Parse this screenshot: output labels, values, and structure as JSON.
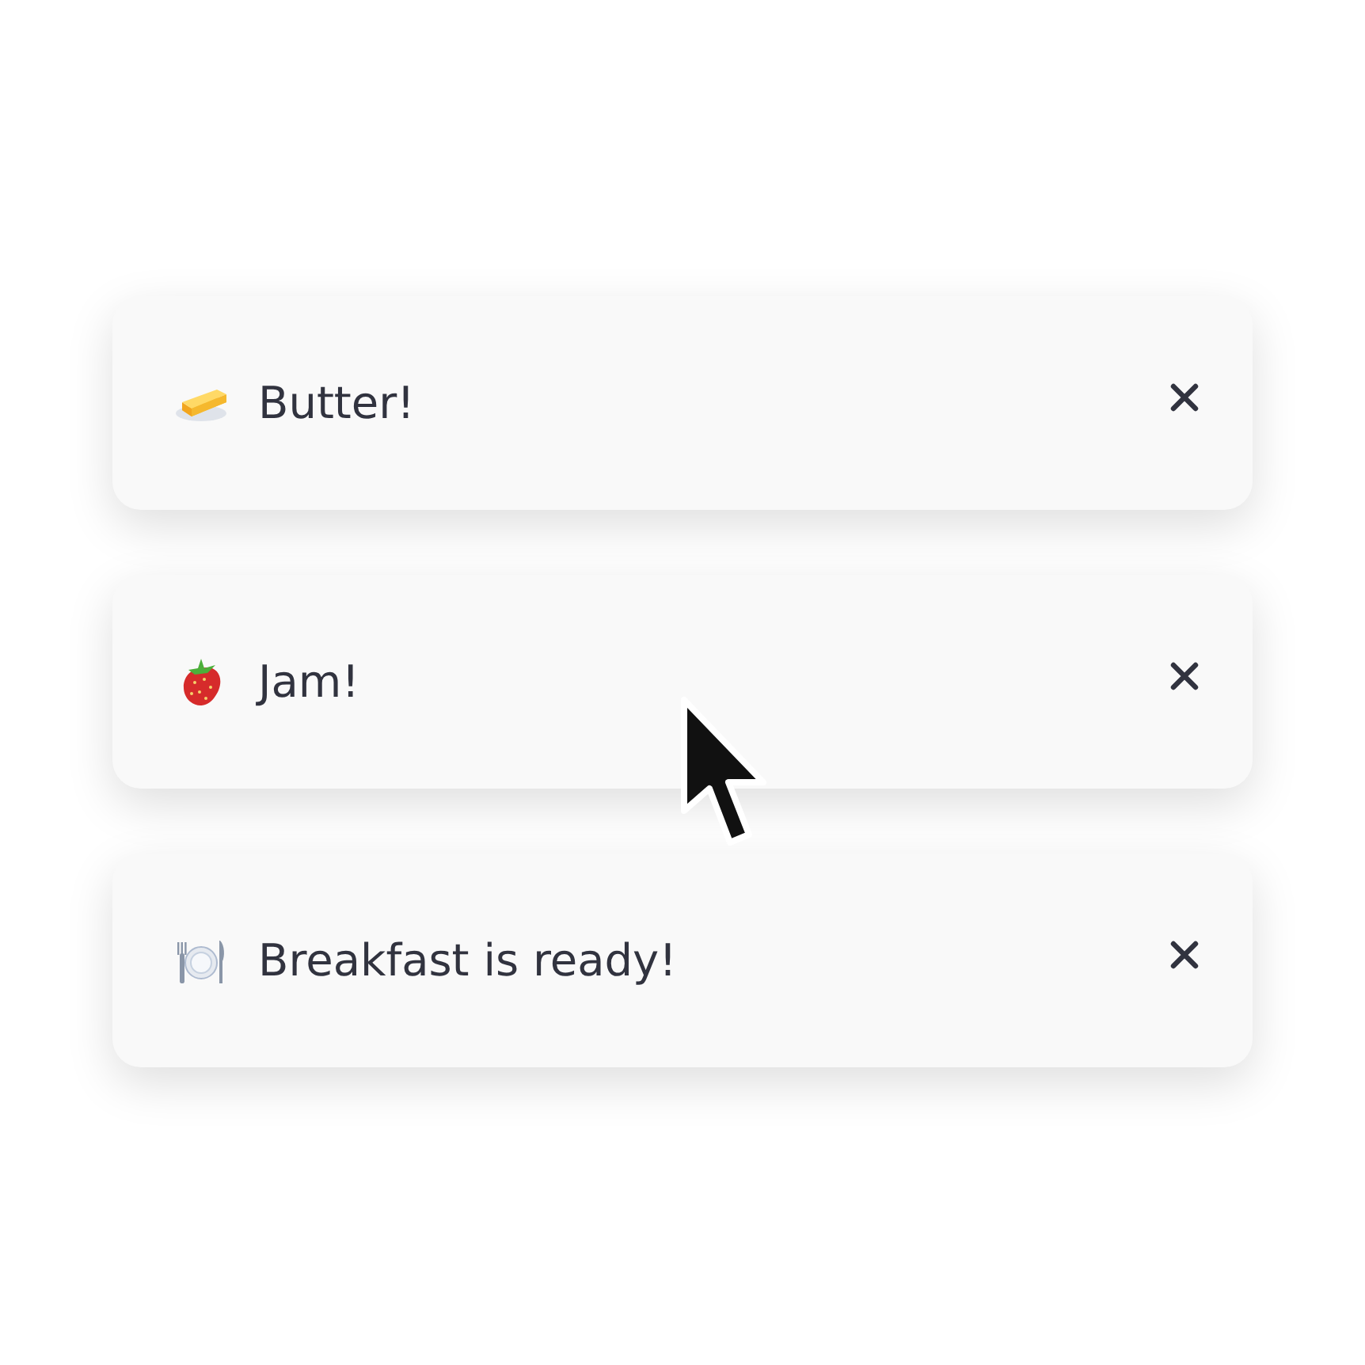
{
  "toasts": [
    {
      "kind": "butter",
      "message": "Butter!"
    },
    {
      "kind": "strawberry",
      "message": "Jam!"
    },
    {
      "kind": "plate",
      "message": "Breakfast is ready!"
    }
  ]
}
